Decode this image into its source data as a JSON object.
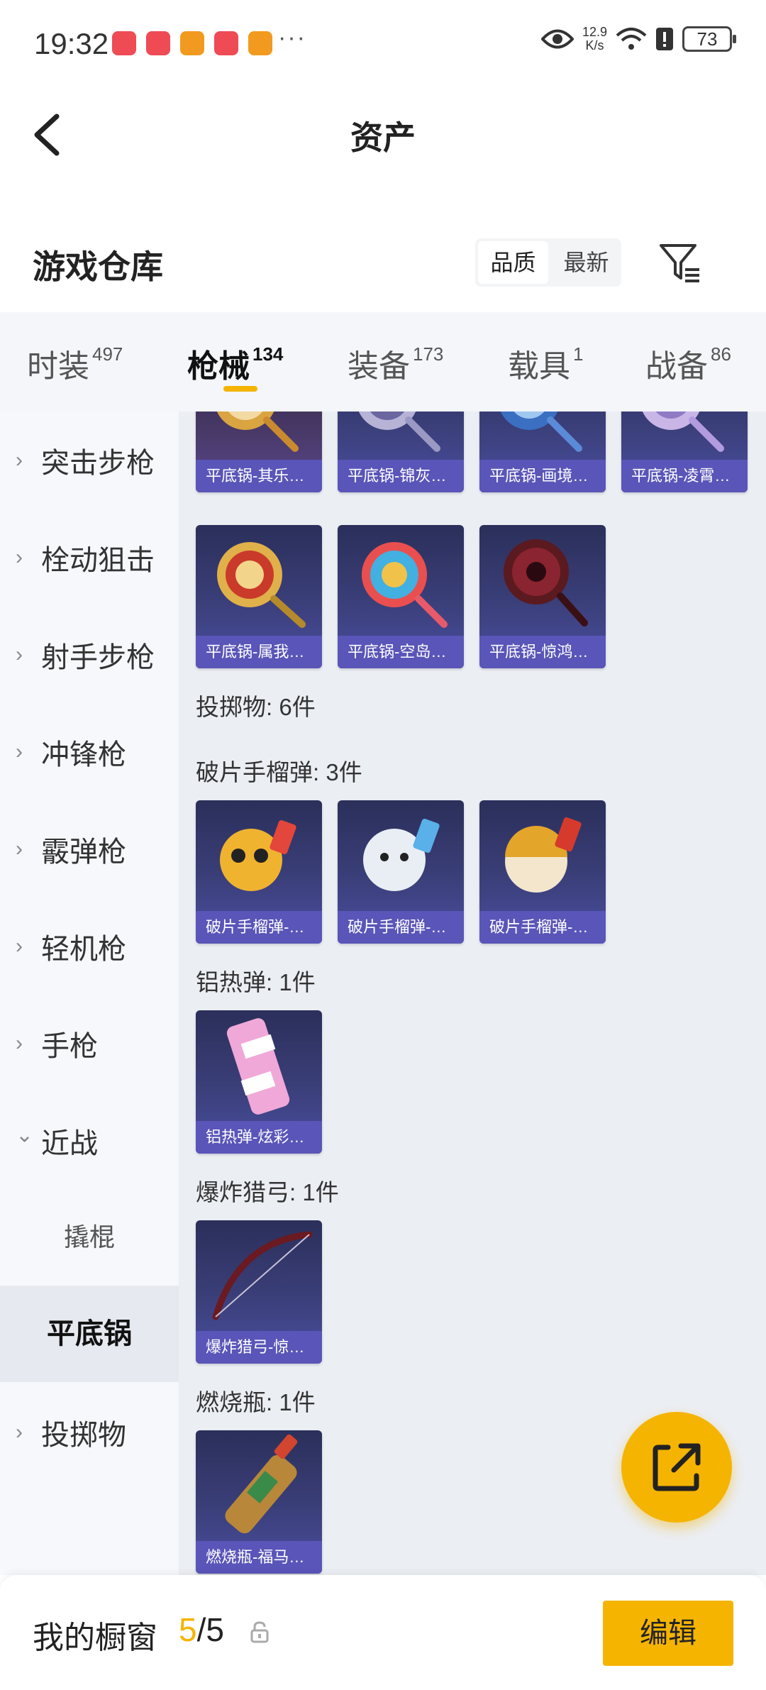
{
  "status_bar": {
    "time": "19:32",
    "more": "···",
    "speed_value": "12.9",
    "speed_unit": "K/s",
    "battery": "73"
  },
  "header": {
    "title": "资产"
  },
  "warehouse": {
    "title": "游戏仓库",
    "sort_options": [
      "品质",
      "最新"
    ],
    "active_sort": "品质"
  },
  "tabs": [
    {
      "label": "时装",
      "count": "497"
    },
    {
      "label": "枪械",
      "count": "134"
    },
    {
      "label": "装备",
      "count": "173"
    },
    {
      "label": "载具",
      "count": "1"
    },
    {
      "label": "战备",
      "count": "86"
    }
  ],
  "active_tab": "枪械",
  "sidebar": {
    "items": [
      {
        "label": "突击步枪",
        "chevron": "›"
      },
      {
        "label": "栓动狙击",
        "chevron": "›"
      },
      {
        "label": "射手步枪",
        "chevron": "›"
      },
      {
        "label": "冲锋枪",
        "chevron": "›"
      },
      {
        "label": "霰弹枪",
        "chevron": "›"
      },
      {
        "label": "轻机枪",
        "chevron": "›"
      },
      {
        "label": "手枪",
        "chevron": "›"
      },
      {
        "label": "近战",
        "chevron": "⌄"
      }
    ],
    "sub_items": [
      {
        "label": "撬棍"
      },
      {
        "label": "平底锅"
      }
    ],
    "last_item": {
      "label": "投掷物",
      "chevron": "›"
    }
  },
  "content": {
    "pan_row1": [
      "平底锅-其乐…",
      "平底锅-锦灰…",
      "平底锅-画境…",
      "平底锅-凌霄…"
    ],
    "pan_row2": [
      "平底锅-属我…",
      "平底锅-空岛…",
      "平底锅-惊鸿…"
    ],
    "throwables_label": "投掷物: 6件",
    "frag_label": "破片手榴弹: 3件",
    "frag_items": [
      "破片手榴弹-…",
      "破片手榴弹-…",
      "破片手榴弹-…"
    ],
    "thermite_label": "铝热弹: 1件",
    "thermite_items": [
      "铝热弹-炫彩…"
    ],
    "bow_label": "爆炸猎弓: 1件",
    "bow_items": [
      "爆炸猎弓-惊…"
    ],
    "molotov_label": "燃烧瓶: 1件",
    "molotov_items": [
      "燃烧瓶-福马…"
    ]
  },
  "bottom_bar": {
    "window_label": "我的橱窗",
    "current": "5",
    "separator": "/",
    "total": "5",
    "edit_label": "编辑"
  },
  "colors": {
    "accent": "#f5b400",
    "card_caption": "#5a55b8",
    "content_bg": "#ebeef3"
  },
  "icons": [
    "back-arrow-icon",
    "filter-icon",
    "share-external-icon",
    "lock-icon",
    "eye-icon",
    "wifi-icon",
    "battery-icon"
  ]
}
